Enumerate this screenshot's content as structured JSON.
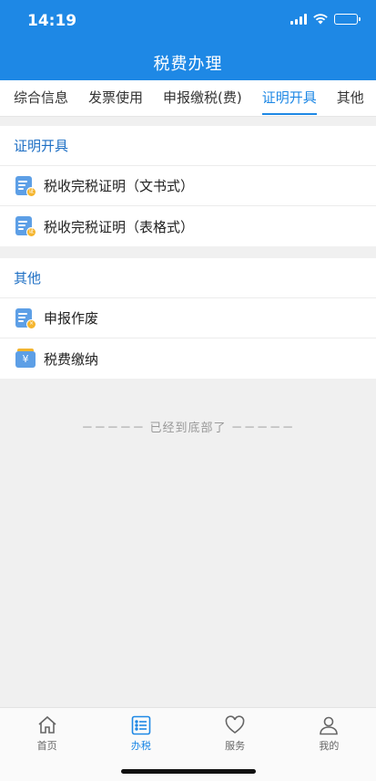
{
  "status": {
    "time": "14:19"
  },
  "header": {
    "title": "税费办理"
  },
  "tabs": [
    {
      "label": "综合信息",
      "active": false
    },
    {
      "label": "发票使用",
      "active": false
    },
    {
      "label": "申报缴税(费)",
      "active": false
    },
    {
      "label": "证明开具",
      "active": true
    },
    {
      "label": "其他",
      "active": false
    }
  ],
  "sections": [
    {
      "title": "证明开具",
      "items": [
        {
          "label": "税收完税证明（文书式）",
          "icon": "certificate-doc-icon"
        },
        {
          "label": "税收完税证明（表格式）",
          "icon": "certificate-doc-icon"
        }
      ]
    },
    {
      "title": "其他",
      "items": [
        {
          "label": "申报作废",
          "icon": "void-declaration-icon"
        },
        {
          "label": "税费缴纳",
          "icon": "tax-payment-wallet-icon"
        }
      ]
    }
  ],
  "footer_note": "－－－－－  已经到底部了  －－－－－",
  "tabbar": [
    {
      "label": "首页",
      "icon": "home-icon",
      "active": false
    },
    {
      "label": "办税",
      "icon": "list-icon",
      "active": true
    },
    {
      "label": "服务",
      "icon": "heart-icon",
      "active": false
    },
    {
      "label": "我的",
      "icon": "user-icon",
      "active": false
    }
  ],
  "colors": {
    "primary": "#1e88e5",
    "accent": "#f5b52e",
    "background": "#f0f0f0"
  }
}
